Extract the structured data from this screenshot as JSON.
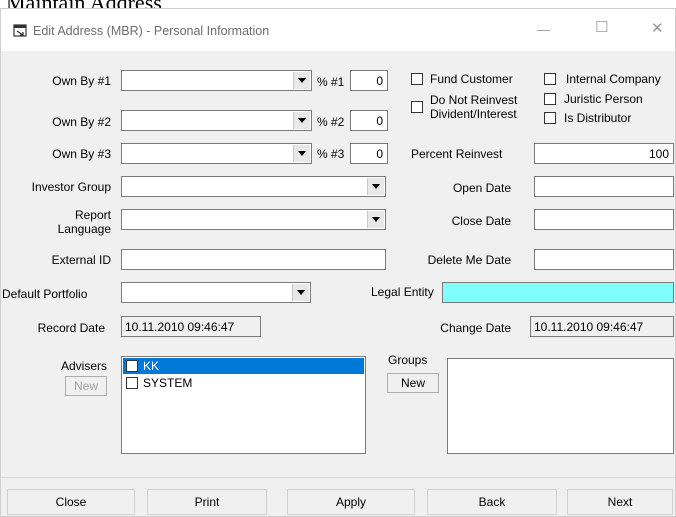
{
  "header_text": "Maintain Address",
  "window": {
    "title": "Edit Address (MBR) - Personal Information",
    "minimize": "—",
    "maximize": "☐",
    "close": "✕"
  },
  "ownership": [
    {
      "label": "Own By #1",
      "pct_label": "% #1",
      "pct_value": "0"
    },
    {
      "label": "Own By #2",
      "pct_label": "% #2",
      "pct_value": "0"
    },
    {
      "label": "Own By #3",
      "pct_label": "% #3",
      "pct_value": "0"
    }
  ],
  "checkboxes": {
    "fund_customer": "Fund Customer",
    "internal_company": "Internal Company",
    "do_not_reinvest_1": "Do Not Reinvest",
    "do_not_reinvest_2": "Divident/Interest",
    "juristic_person": "Juristic Person",
    "is_distributor": "Is Distributor"
  },
  "percent_reinvest": {
    "label": "Percent Reinvest",
    "value": "100"
  },
  "investor_group": {
    "label": "Investor Group"
  },
  "report_language": {
    "label_1": "Report",
    "label_2": "Language"
  },
  "external_id": {
    "label": "External ID"
  },
  "default_portfolio": {
    "label": "Default Portfolio"
  },
  "legal_entity": {
    "label": "Legal Entity",
    "color": "#80ffff"
  },
  "open_date": {
    "label": "Open Date"
  },
  "close_date": {
    "label": "Close Date"
  },
  "delete_me_date": {
    "label": "Delete Me Date"
  },
  "record_date": {
    "label": "Record Date",
    "value": "10.11.2010 09:46:47"
  },
  "change_date": {
    "label": "Change Date",
    "value": "10.11.2010 09:46:47"
  },
  "advisers": {
    "label": "Advisers",
    "new_button": "New",
    "items": [
      {
        "name": "KK",
        "selected": true
      },
      {
        "name": "SYSTEM",
        "selected": false
      }
    ]
  },
  "groups": {
    "label": "Groups",
    "new_button": "New"
  },
  "footer_buttons": {
    "close": "Close",
    "print": "Print",
    "apply": "Apply",
    "back": "Back",
    "next": "Next"
  },
  "colors": {
    "selection": "#0078d7",
    "accent_cyan": "#80ffff"
  }
}
